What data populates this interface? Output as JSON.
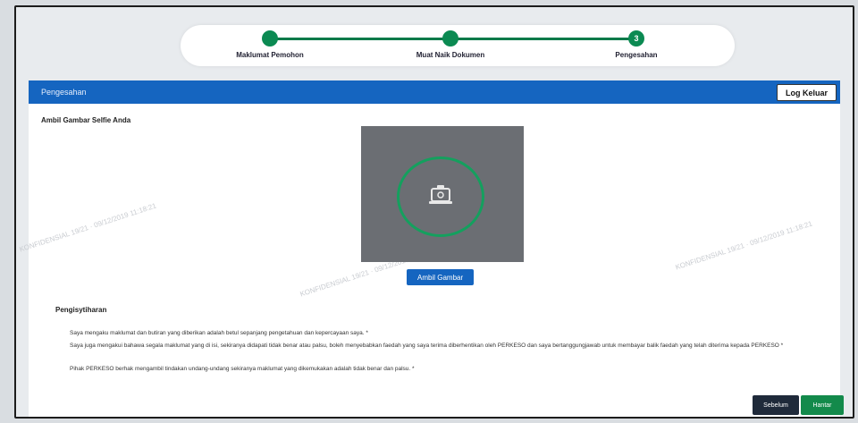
{
  "stepper": {
    "steps": [
      {
        "label": "Maklumat Pemohon",
        "number": ""
      },
      {
        "label": "Muat Naik Dokumen",
        "number": ""
      },
      {
        "label": "Pengesahan",
        "number": "3"
      }
    ]
  },
  "panel": {
    "title": "Pengesahan",
    "logout_label": "Log Keluar",
    "section_title": "Ambil Gambar Selfie Anda",
    "capture_label": "Ambil Gambar"
  },
  "watermark": {
    "text": "KONFIDENSIAL 19/21 · 09/12/2019 11:18:21"
  },
  "declaration": {
    "title": "Pengisytiharan",
    "items": [
      "Saya mengaku maklumat dan butiran yang diberikan adalah betul sepanjang pengetahuan dan kepercayaan saya. *",
      "Saya juga mengakui bahawa segala maklumat yang di isi, sekiranya didapati tidak benar atau palsu, boleh menyebabkan faedah yang saya terima diberhentikan oleh PERKESO dan saya bertanggungjawab untuk membayar balik faedah yang telah diterima kepada PERKESO *",
      "Pihak PERKESO berhak mengambil tindakan undang-undang sekiranya maklumat yang dikemukakan adalah tidak benar dan palsu. *"
    ]
  },
  "footer": {
    "back_label": "Sebelum",
    "next_label": "Hantar"
  },
  "colors": {
    "primary": "#1565c0",
    "success": "#138a4b",
    "dark": "#1f2a3a"
  }
}
